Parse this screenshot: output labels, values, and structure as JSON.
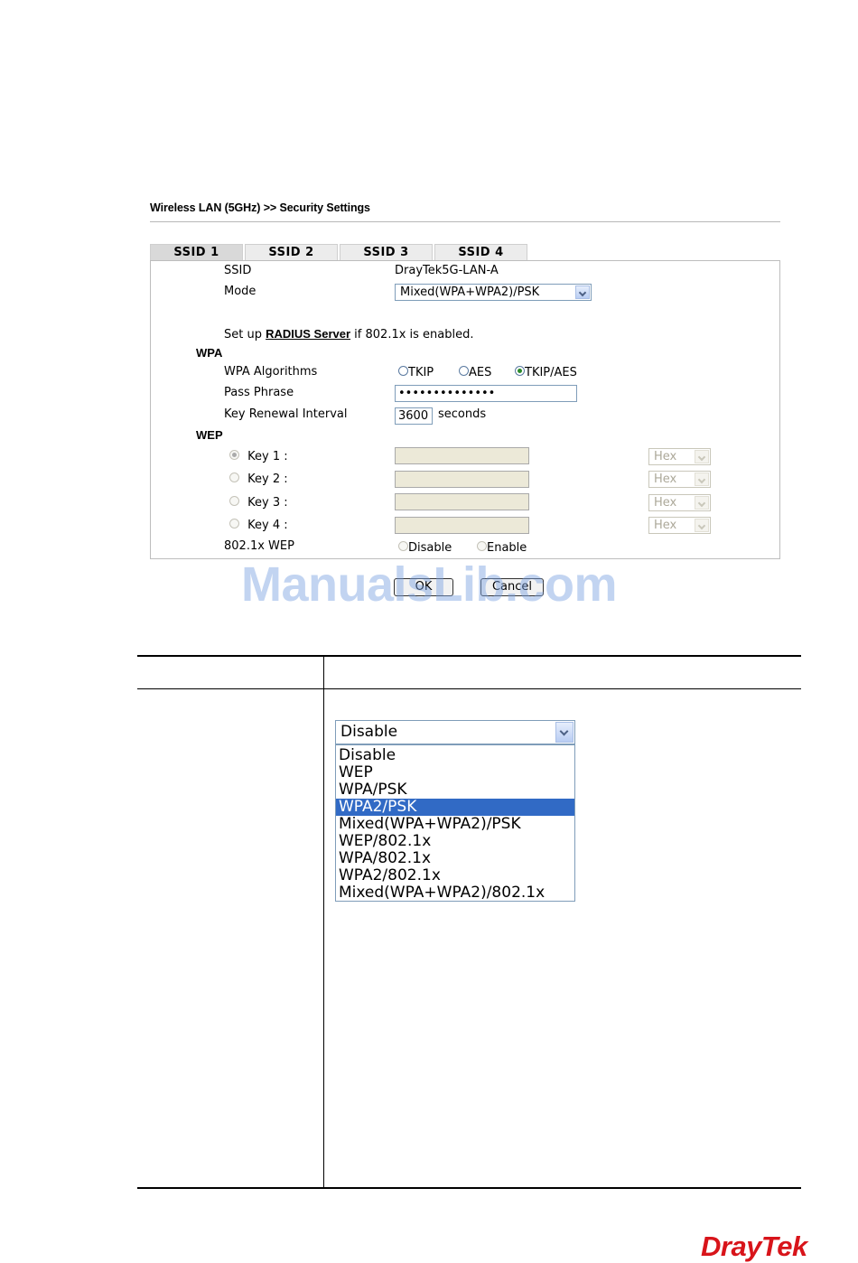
{
  "breadcrumb": "Wireless LAN (5GHz) >> Security Settings",
  "tabs": [
    "SSID 1",
    "SSID 2",
    "SSID 3",
    "SSID 4"
  ],
  "form": {
    "ssid_label": "SSID",
    "ssid_value": "DrayTek5G-LAN-A",
    "mode_label": "Mode",
    "mode_value": "Mixed(WPA+WPA2)/PSK",
    "radius_prefix": "Set up ",
    "radius_link": "RADIUS Server",
    "radius_suffix": " if 802.1x is enabled.",
    "wpa_heading": "WPA",
    "wpa_algorithms_label": "WPA Algorithms",
    "algo_tkip": "TKIP",
    "algo_aes": "AES",
    "algo_tkip_aes": "TKIP/AES",
    "algo_selected": "TKIP/AES",
    "pass_phrase_label": "Pass Phrase",
    "pass_phrase_value": "••••••••••••••",
    "key_renewal_label": "Key Renewal Interval",
    "key_renewal_value": "3600",
    "key_renewal_unit": "seconds",
    "wep_heading": "WEP",
    "keys": [
      {
        "label": "Key 1 :",
        "format": "Hex",
        "selected": true
      },
      {
        "label": "Key 2 :",
        "format": "Hex",
        "selected": false
      },
      {
        "label": "Key 3 :",
        "format": "Hex",
        "selected": false
      },
      {
        "label": "Key 4 :",
        "format": "Hex",
        "selected": false
      }
    ],
    "wep_8021x_label": "802.1x WEP",
    "wep_8021x_disable": "Disable",
    "wep_8021x_enable": "Enable"
  },
  "buttons": {
    "ok": "OK",
    "cancel": "Cancel"
  },
  "watermark": "ManualsLib.com",
  "mode_dropdown": {
    "current": "Disable",
    "options": [
      "Disable",
      "WEP",
      "WPA/PSK",
      "WPA2/PSK",
      "Mixed(WPA+WPA2)/PSK",
      "WEP/802.1x",
      "WPA/802.1x",
      "WPA2/802.1x",
      "Mixed(WPA+WPA2)/802.1x"
    ],
    "highlighted": "WPA2/PSK"
  },
  "logo": "DrayTek",
  "colors": {
    "highlight": "#316ac5",
    "logo": "#d8141a",
    "watermark": "#78a0e1"
  }
}
